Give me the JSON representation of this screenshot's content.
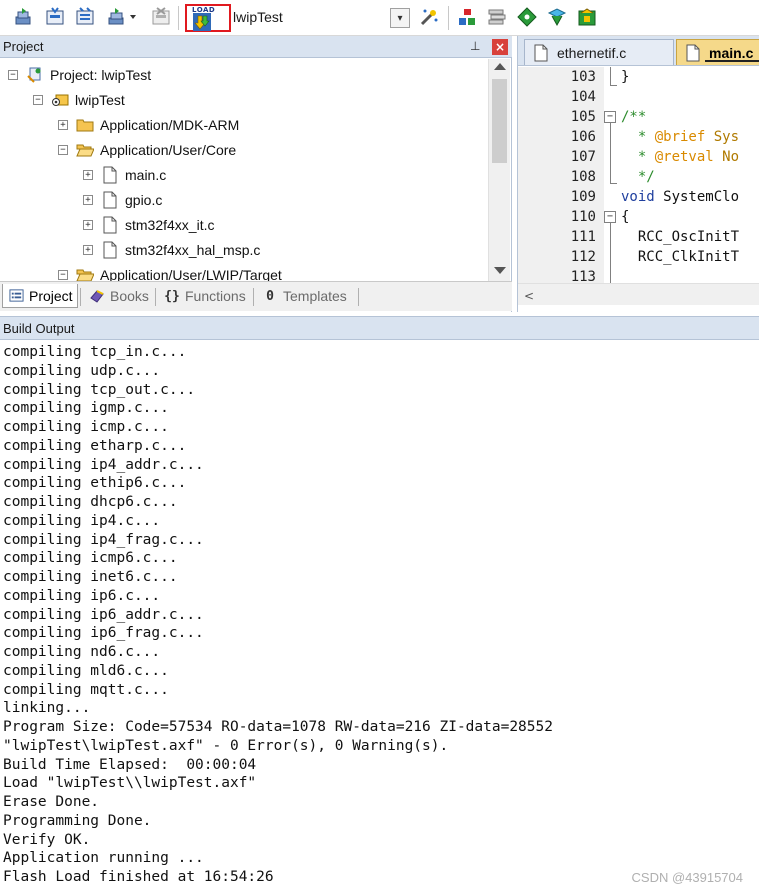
{
  "toolbar": {
    "target_name": "lwipTest",
    "load_label": "LOAD",
    "dropdown_arrow": "▾",
    "accent_color": "#e0191f"
  },
  "project_panel": {
    "title": "Project",
    "pin": "⊥",
    "close": "×",
    "tree": [
      {
        "label": "Project: lwipTest",
        "expander": "−",
        "icon": "project-icon"
      },
      {
        "label": "lwipTest",
        "expander": "−",
        "icon": "target-icon"
      },
      {
        "label": "Application/MDK-ARM",
        "expander": "+",
        "icon": "folder-icon"
      },
      {
        "label": "Application/User/Core",
        "expander": "−",
        "icon": "folder-open-icon"
      },
      {
        "label": "main.c",
        "expander": "+",
        "icon": "file-icon"
      },
      {
        "label": "gpio.c",
        "expander": "+",
        "icon": "file-icon"
      },
      {
        "label": "stm32f4xx_it.c",
        "expander": "+",
        "icon": "file-icon"
      },
      {
        "label": "stm32f4xx_hal_msp.c",
        "expander": "+",
        "icon": "file-icon"
      },
      {
        "label": "Application/User/LWIP/Target",
        "expander": "−",
        "icon": "folder-open-icon"
      }
    ],
    "tabs": [
      {
        "label": "Project",
        "icon": "project-tab-icon"
      },
      {
        "label": "Books",
        "icon": "books-icon"
      },
      {
        "label": "Functions",
        "icon": "functions-icon",
        "glyph": "{}"
      },
      {
        "label": "Templates",
        "icon": "templates-icon",
        "glyph": "0"
      }
    ]
  },
  "editor": {
    "tabs": [
      {
        "label": "ethernetif.c"
      },
      {
        "label": "main.c"
      }
    ],
    "lines": [
      {
        "num": "103",
        "text": "}",
        "cls": "c-plain"
      },
      {
        "num": "104",
        "text": "",
        "cls": "c-plain"
      },
      {
        "num": "105",
        "text": "/**",
        "cls": "c-comment",
        "fold": "−"
      },
      {
        "num": "106",
        "text": "  * @brief Sys",
        "cls": "c-comment"
      },
      {
        "num": "107",
        "text": "  * @retval No",
        "cls": "c-comment"
      },
      {
        "num": "108",
        "text": "  */",
        "cls": "c-comment"
      },
      {
        "num": "109",
        "text": "void SystemClo",
        "cls": "c-kwline"
      },
      {
        "num": "110",
        "text": "{",
        "cls": "c-plain",
        "fold": "−"
      },
      {
        "num": "111",
        "text": "  RCC_OscInitT",
        "cls": "c-plain"
      },
      {
        "num": "112",
        "text": "  RCC_ClkInitT",
        "cls": "c-plain"
      },
      {
        "num": "113",
        "text": "",
        "cls": "c-plain"
      }
    ],
    "scroll_left": "<"
  },
  "build_output": {
    "title": "Build Output",
    "lines": [
      "compiling tcp_in.c...",
      "compiling udp.c...",
      "compiling tcp_out.c...",
      "compiling igmp.c...",
      "compiling icmp.c...",
      "compiling etharp.c...",
      "compiling ip4_addr.c...",
      "compiling ethip6.c...",
      "compiling dhcp6.c...",
      "compiling ip4.c...",
      "compiling ip4_frag.c...",
      "compiling icmp6.c...",
      "compiling inet6.c...",
      "compiling ip6.c...",
      "compiling ip6_addr.c...",
      "compiling ip6_frag.c...",
      "compiling nd6.c...",
      "compiling mld6.c...",
      "compiling mqtt.c...",
      "linking...",
      "Program Size: Code=57534 RO-data=1078 RW-data=216 ZI-data=28552",
      "\"lwipTest\\lwipTest.axf\" - 0 Error(s), 0 Warning(s).",
      "Build Time Elapsed:  00:00:04",
      "Load \"lwipTest\\\\lwipTest.axf\"",
      "Erase Done.",
      "Programming Done.",
      "Verify OK.",
      "Application running ...",
      "Flash Load finished at 16:54:26"
    ]
  },
  "watermark": "CSDN @43915704"
}
